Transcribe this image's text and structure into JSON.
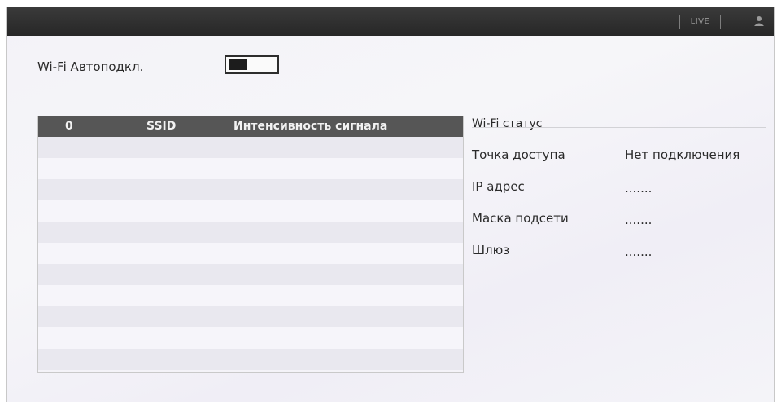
{
  "header": {
    "live_label": "LIVE"
  },
  "wifi_auto": {
    "label": "Wi-Fi Автоподкл.",
    "enabled": false
  },
  "network_table": {
    "columns": [
      "0",
      "SSID",
      "Интенсивность сигнала"
    ],
    "rows": []
  },
  "status": {
    "title": "Wi-Fi статус",
    "items": [
      {
        "label": "Точка доступа",
        "value": "Нет подключения"
      },
      {
        "label": "IP адрес",
        "value": "......."
      },
      {
        "label": "Маска подсети",
        "value": "......."
      },
      {
        "label": "Шлюз",
        "value": "......."
      }
    ]
  },
  "colors": {
    "header_bg": "#2c2c2c",
    "table_header_bg": "#565656",
    "text": "#2a2a2a"
  }
}
